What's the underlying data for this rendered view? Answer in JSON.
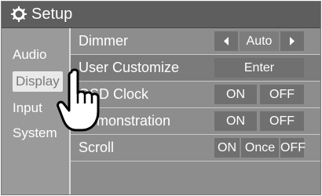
{
  "header": {
    "title": "Setup",
    "icon": "gear-icon"
  },
  "sidebar": {
    "items": [
      {
        "label": "Audio"
      },
      {
        "label": "Display",
        "active": true
      },
      {
        "label": "Input"
      },
      {
        "label": "System"
      }
    ]
  },
  "rows": [
    {
      "label": "Dimmer",
      "value": "Auto"
    },
    {
      "label": "User Customize",
      "button": "Enter"
    },
    {
      "label": "OSD Clock",
      "on": "ON",
      "off": "OFF"
    },
    {
      "label": "Demonstration",
      "on": "ON",
      "off": "OFF"
    },
    {
      "label": "Scroll",
      "on": "ON",
      "once": "Once",
      "off": "OFF"
    }
  ],
  "colors": {
    "panel": "#8d8d8d",
    "titlebar": "#5e5e5e",
    "button": "#707070"
  }
}
